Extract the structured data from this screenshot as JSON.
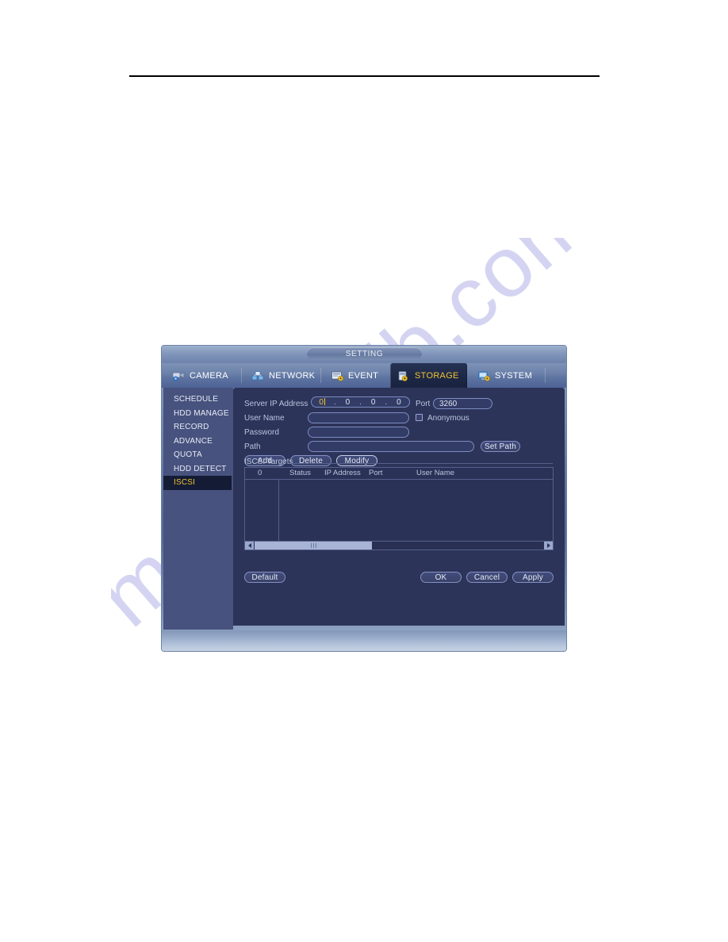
{
  "watermark": {
    "text": "manualslib.com"
  },
  "window": {
    "title": "SETTING",
    "tabs": [
      {
        "label": "CAMERA",
        "icon": "camera-icon",
        "active": false
      },
      {
        "label": "NETWORK",
        "icon": "network-icon",
        "active": false
      },
      {
        "label": "EVENT",
        "icon": "event-icon",
        "active": false
      },
      {
        "label": "STORAGE",
        "icon": "storage-icon",
        "active": true
      },
      {
        "label": "SYSTEM",
        "icon": "system-icon",
        "active": false
      }
    ]
  },
  "sidebar": {
    "items": [
      {
        "label": "SCHEDULE",
        "active": false
      },
      {
        "label": "HDD MANAGE",
        "active": false
      },
      {
        "label": "RECORD",
        "active": false
      },
      {
        "label": "ADVANCE",
        "active": false
      },
      {
        "label": "QUOTA",
        "active": false
      },
      {
        "label": "HDD DETECT",
        "active": false
      },
      {
        "label": "ISCSI",
        "active": true
      }
    ]
  },
  "form": {
    "server_ip_label": "Server IP Address",
    "server_ip_octets": [
      "0",
      "0",
      "0",
      "0"
    ],
    "port_label": "Port",
    "port_value": "3260",
    "user_name_label": "User Name",
    "user_name_value": "",
    "anonymous_label": "Anonymous",
    "anonymous_checked": false,
    "password_label": "Password",
    "password_value": "",
    "path_label": "Path",
    "path_value": "",
    "set_path_label": "Set Path",
    "add_label": "Add",
    "delete_label": "Delete",
    "modify_label": "Modify"
  },
  "targets": {
    "group_label": "ISCSI Targets",
    "columns": [
      "0",
      "Status",
      "IP Address",
      "Port",
      "User Name"
    ],
    "rows": []
  },
  "footer": {
    "default_label": "Default",
    "ok_label": "OK",
    "cancel_label": "Cancel",
    "apply_label": "Apply"
  },
  "colors": {
    "accent_yellow": "#f2c230",
    "panel_bg": "#2d3459",
    "sidebar_bg": "#47527e",
    "active_item_bg": "#141c35"
  }
}
